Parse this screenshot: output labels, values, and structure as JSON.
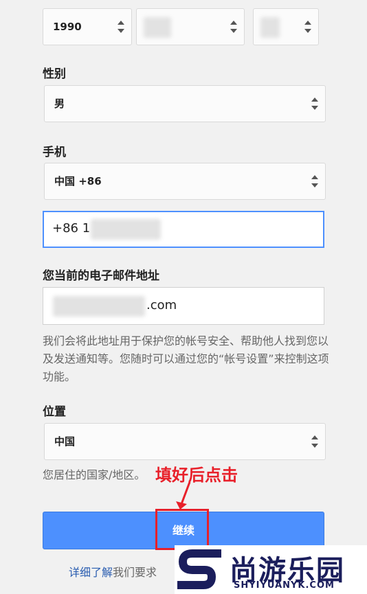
{
  "birthdate": {
    "year": "1990"
  },
  "gender": {
    "label": "性别",
    "value": "男"
  },
  "phone": {
    "label": "手机",
    "country": "中国 +86",
    "number_prefix": "+86 1"
  },
  "email": {
    "label": "您当前的电子邮件地址",
    "suffix": ".com",
    "help": "我们会将此地址用于保护您的帐号安全、帮助他人找到您以及发送通知等。您随时可以通过您的“帐号设置”来控制这项功能。"
  },
  "location": {
    "label": "位置",
    "value": "中国",
    "help": "您居住的国家/地区。"
  },
  "continue_button": {
    "label": "继续"
  },
  "annotation": {
    "text": "填好后点击"
  },
  "footer": {
    "link": "详细了解",
    "text": "我们要求"
  },
  "watermark": {
    "title": "尚游乐园",
    "url": "SHYIYUANYK.COM"
  },
  "colors": {
    "accent": "#4d90fe",
    "annotation": "#e8202a",
    "brand": "#1b1e5c"
  }
}
